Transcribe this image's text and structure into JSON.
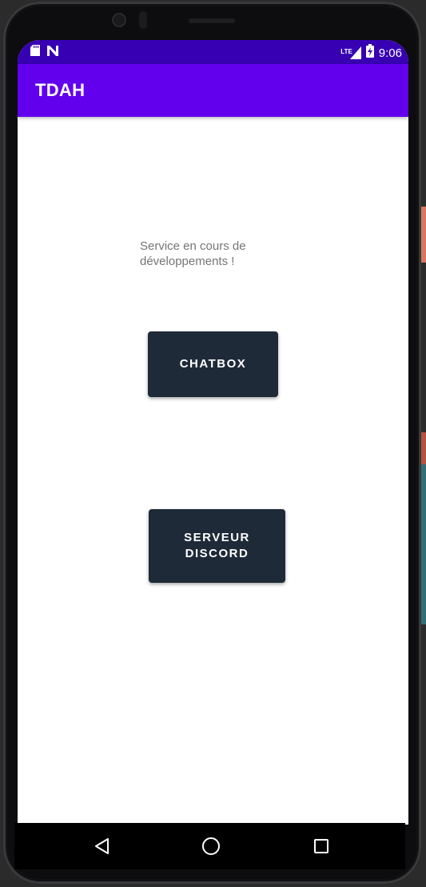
{
  "status_bar": {
    "time": "9:06",
    "network_type": "LTE",
    "icons": [
      "sd-card-icon",
      "n-notification-icon",
      "lte-signal-icon",
      "battery-charging-icon"
    ]
  },
  "app_bar": {
    "title": "TDAH"
  },
  "main": {
    "dev_message": "Service en cours de développements !",
    "chatbox_button_label": "CHATBOX",
    "discord_button_label": "SERVEUR\nDISCORD"
  },
  "nav_bar": {
    "icons": [
      "back-icon",
      "home-icon",
      "recents-icon"
    ]
  },
  "colors": {
    "status_bar": "#3700b3",
    "app_bar": "#6200ee",
    "button_background": "#1f2a38",
    "button_text": "#ffffff",
    "body_text": "#757575",
    "screen_background": "#ffffff"
  }
}
